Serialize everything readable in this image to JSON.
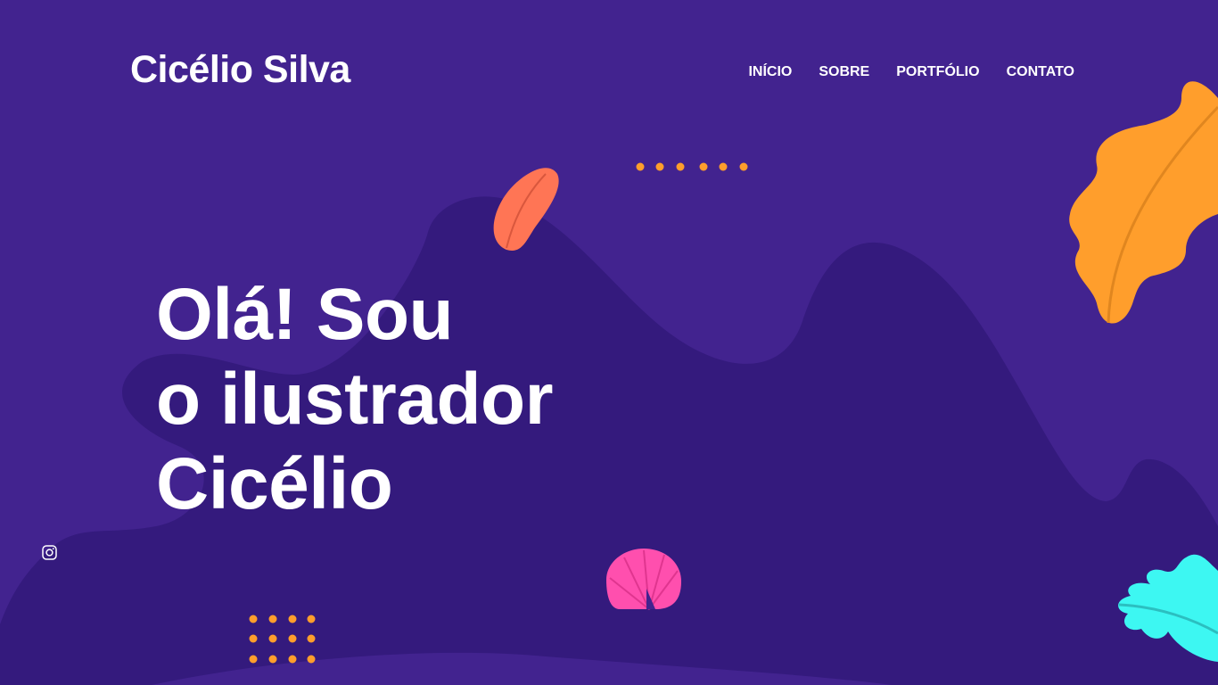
{
  "header": {
    "brand": "Cicélio Silva",
    "nav": [
      {
        "label": "INÍCIO"
      },
      {
        "label": "SOBRE"
      },
      {
        "label": "PORTFÓLIO"
      },
      {
        "label": "CONTATO"
      }
    ]
  },
  "hero": {
    "lines": [
      "Olá! Sou",
      "o ilustrador",
      "Cicélio"
    ]
  },
  "social": {
    "instagram_icon": "instagram-icon"
  },
  "colors": {
    "background": "#42238F",
    "background_shape": "#341A7D",
    "orange_leaf": "#FF9E2C",
    "coral_leaf": "#FF7555",
    "pink_shell": "#FF4FAE",
    "cyan_leaf": "#3DF7F2",
    "dots": "#FF9E2C",
    "text": "#FFFFFF"
  }
}
